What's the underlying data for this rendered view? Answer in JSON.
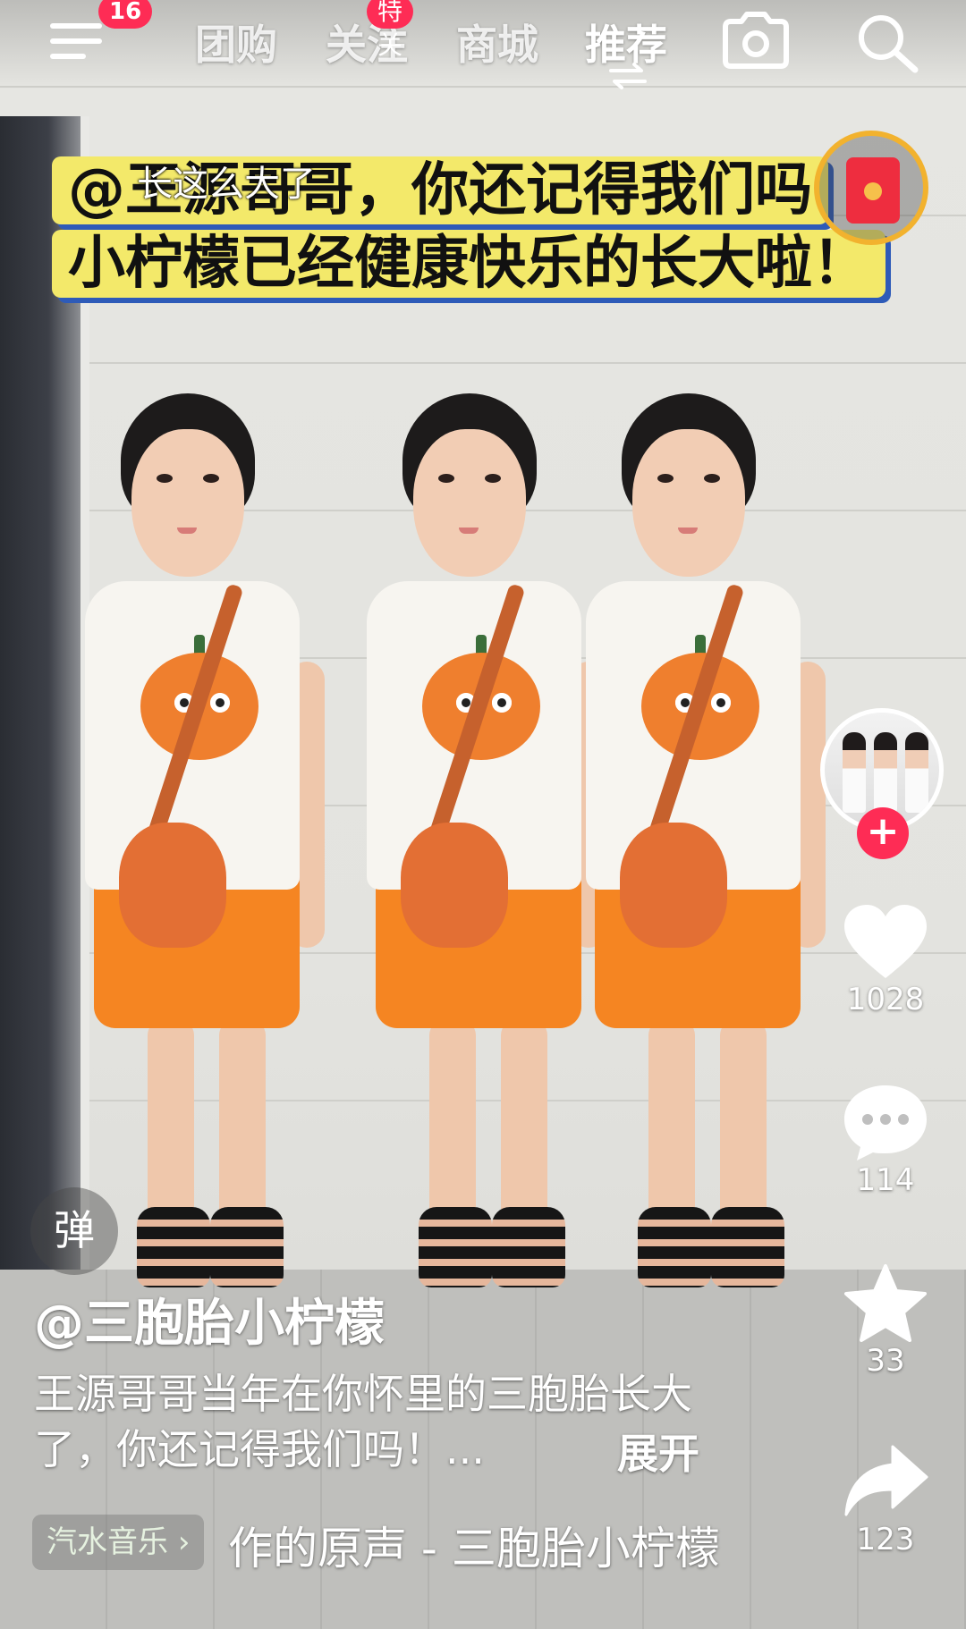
{
  "top_nav": {
    "menu_badge": "16",
    "tabs": [
      {
        "label": "团购"
      },
      {
        "label": "关注",
        "badge": "特关"
      },
      {
        "label": "商城"
      },
      {
        "label": "推荐",
        "active": true
      }
    ],
    "icons": [
      "menu-icon",
      "swap-icon",
      "camera-icon",
      "search-icon"
    ]
  },
  "video_caption": {
    "small_text": "长这么大了",
    "line1": "@王源哥哥，你还记得我们吗",
    "line2": "小柠檬已经健康快乐的长大啦！"
  },
  "side_actions": {
    "follow_symbol": "+",
    "like_count": "1028",
    "comment_count": "114",
    "favorite_count": "33",
    "share_count": "123"
  },
  "danmaku_label": "弹",
  "post": {
    "author": "@三胞胎小柠檬",
    "description": "王源哥哥当年在你怀里的三胞胎长大了，你还记得我们吗！...",
    "expand_label": "展开",
    "music_tag": "汽水音乐",
    "music_title": "作的原声 - 三胞胎小柠檬"
  },
  "colors": {
    "accent_red": "#fe2c55",
    "caption_yellow": "#f3e96a",
    "caption_shadow_blue": "#2e5bb8",
    "shorts_orange": "#f58522"
  }
}
